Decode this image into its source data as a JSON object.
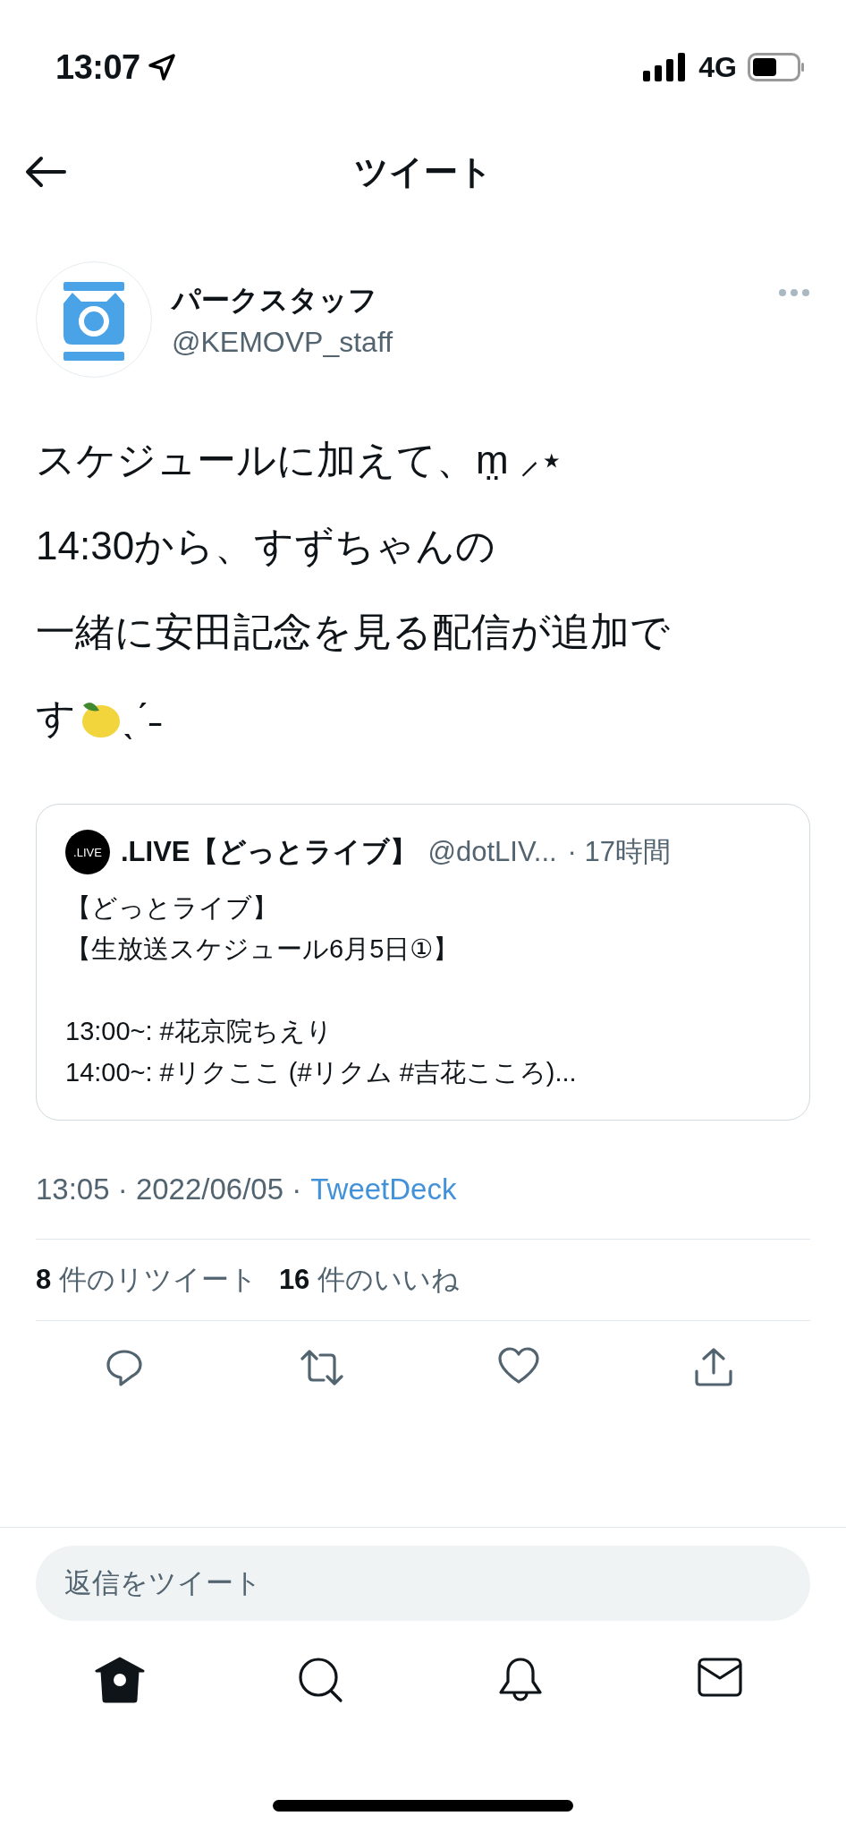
{
  "status_bar": {
    "time": "13:07",
    "network": "4G"
  },
  "header": {
    "title": "ツイート"
  },
  "author": {
    "name": "パークスタッフ",
    "handle": "@KEMOVP_staff"
  },
  "tweet": {
    "lines": [
      "スケジュールに加えて、m̤ ⸝⋆",
      "14:30から、すずちゃんの",
      "一緒に安田記念を見る配信が追加で"
    ],
    "closing_before": "す",
    "closing_after": "ˎˊ˗"
  },
  "quoted": {
    "avatar_text": ".LIVE",
    "name": ".LIVE【どっとライブ】",
    "handle": "@dotLIV...",
    "time": "· 17時間",
    "paragraphs": [
      [
        "【どっとライブ】",
        "【生放送スケジュール6月5日①】"
      ],
      [
        "13:00~: #花京院ちえり",
        "14:00~: #リクここ (#リクム #吉花こころ)..."
      ]
    ]
  },
  "meta": {
    "time": "13:05 · 2022/06/05 ·",
    "source": "TweetDeck"
  },
  "stats": [
    {
      "count": "8",
      "label": "件のリツイート"
    },
    {
      "count": "16",
      "label": "件のいいね"
    }
  ],
  "actions": [
    {
      "kind": "reply"
    },
    {
      "kind": "retweet"
    },
    {
      "kind": "like"
    },
    {
      "kind": "share"
    }
  ],
  "reply": {
    "placeholder": "返信をツイート"
  },
  "tabs": [
    {
      "kind": "home",
      "selected": true
    },
    {
      "kind": "search",
      "selected": false
    },
    {
      "kind": "notifications",
      "selected": false
    },
    {
      "kind": "messages",
      "selected": false
    }
  ]
}
